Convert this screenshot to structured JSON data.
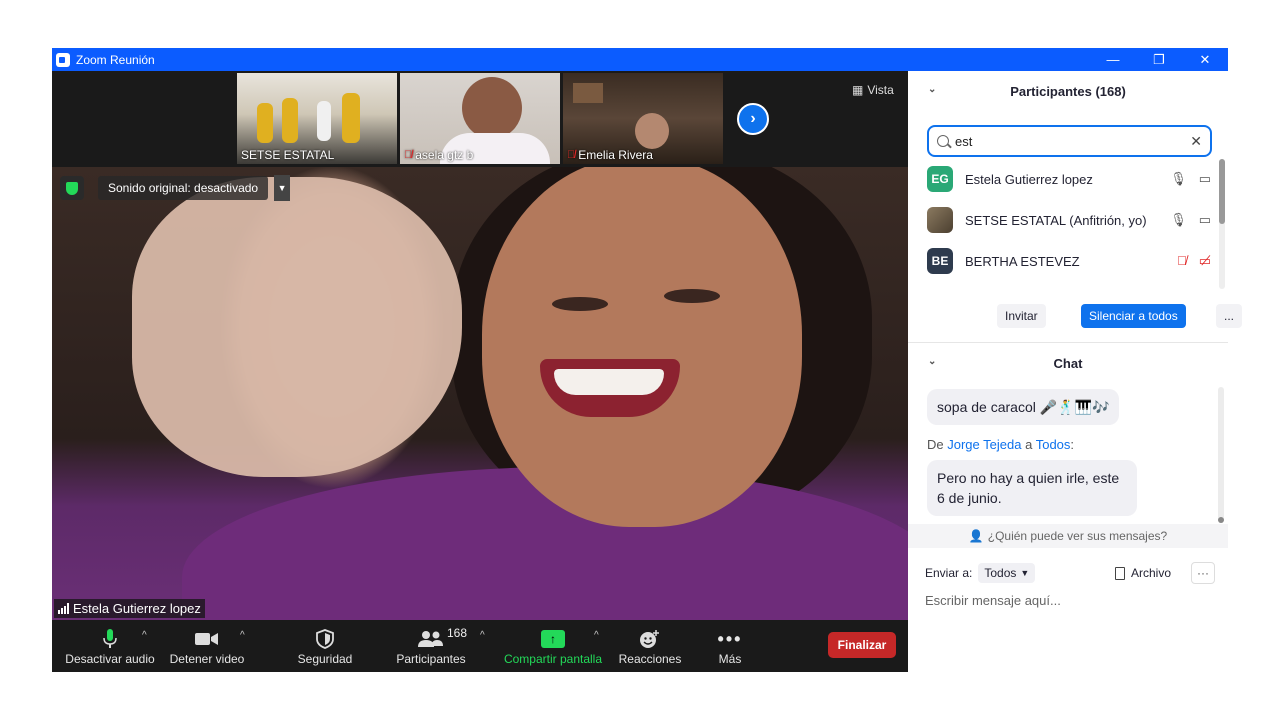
{
  "titlebar": {
    "title": "Zoom Reunión",
    "minimize": "—",
    "restore": "❐",
    "close": "✕"
  },
  "thumbnails": [
    {
      "name": "SETSE ESTATAL",
      "muted": false
    },
    {
      "name": "asela gtz b",
      "muted": true
    },
    {
      "name": "Emelia Rivera",
      "muted": true
    }
  ],
  "view": {
    "label": "Vista"
  },
  "main_video": {
    "sound_status": "Sonido original: desactivado",
    "speaker_name": "Estela Gutierrez lopez"
  },
  "toolbar": {
    "mute": "Desactivar audio",
    "video": "Detener video",
    "security": "Seguridad",
    "participants": "Participantes",
    "participant_count": "168",
    "share": "Compartir pantalla",
    "reactions": "Reacciones",
    "more": "Más",
    "end": "Finalizar"
  },
  "participants_panel": {
    "title": "Participantes (168)",
    "search_value": "est",
    "rows": [
      {
        "initials": "EG",
        "name": "Estela Gutierrez lopez",
        "avatar_color": "#2aa876",
        "muted": false
      },
      {
        "initials": "",
        "name": "SETSE ESTATAL (Anfitrión, yo)",
        "avatar_color": "#6b5a48",
        "muted": false
      },
      {
        "initials": "BE",
        "name": "BERTHA ESTEVEZ",
        "avatar_color": "#2e3b4e",
        "muted": true
      }
    ],
    "invite": "Invitar",
    "mute_all": "Silenciar a todos",
    "more": "..."
  },
  "chat_panel": {
    "title": "Chat",
    "messages": [
      {
        "text": "sopa de caracol 🎤🕺🎹🎶"
      },
      {
        "from_prefix": "De",
        "from": "Jorge Tejeda",
        "to_prefix": "a",
        "to": "Todos",
        "text": "Pero no hay a quien irle, este 6 de junio."
      }
    ],
    "who_sees": "¿Quién puede ver sus mensajes?",
    "send_to_label": "Enviar a:",
    "send_to_value": "Todos",
    "file_label": "Archivo",
    "more": "···",
    "placeholder": "Escribir mensaje aquí..."
  },
  "colors": {
    "brand_blue": "#0b5cff",
    "accent_blue": "#0e72ed",
    "end_red": "#c62828",
    "share_green": "#23d959"
  }
}
